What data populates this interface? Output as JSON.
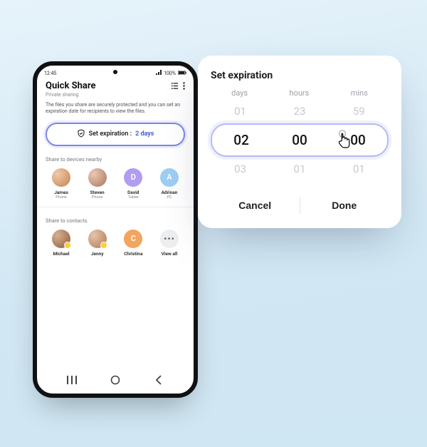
{
  "status": {
    "time": "12:45",
    "signal": "100%"
  },
  "header": {
    "title": "Quick Share",
    "subtitle": "Private sharing",
    "description": "The files you share are securely protected and you can set an expiration date for recipients to view the files."
  },
  "expiration_pill": {
    "label": "Set expiration :",
    "value": "2 days"
  },
  "sections": {
    "nearby_label": "Share to devices nearby",
    "contacts_label": "Share to contacts"
  },
  "nearby": [
    {
      "name": "James",
      "sub": "Phone",
      "kind": "photo"
    },
    {
      "name": "Steven",
      "sub": "Phone",
      "kind": "photo"
    },
    {
      "name": "David",
      "sub": "Tablet",
      "kind": "letter",
      "letter": "D",
      "color": "#b29cf0"
    },
    {
      "name": "Adrinan",
      "sub": "PC",
      "kind": "letter",
      "letter": "A",
      "color": "#9ecdf5"
    }
  ],
  "contacts": [
    {
      "name": "Michael",
      "kind": "photo"
    },
    {
      "name": "Jenny",
      "kind": "photo"
    },
    {
      "name": "Christina",
      "kind": "letter",
      "letter": "C",
      "color": "#f3a45e"
    },
    {
      "name": "View all",
      "kind": "viewall"
    }
  ],
  "picker": {
    "title": "Set expiration",
    "cols": {
      "days": "days",
      "hours": "hours",
      "mins": "mins"
    },
    "prev": {
      "days": "01",
      "hours": "23",
      "mins": "59"
    },
    "sel": {
      "days": "02",
      "hours": "00",
      "mins": "00"
    },
    "next": {
      "days": "03",
      "hours": "01",
      "mins": "01"
    },
    "cancel": "Cancel",
    "done": "Done"
  }
}
